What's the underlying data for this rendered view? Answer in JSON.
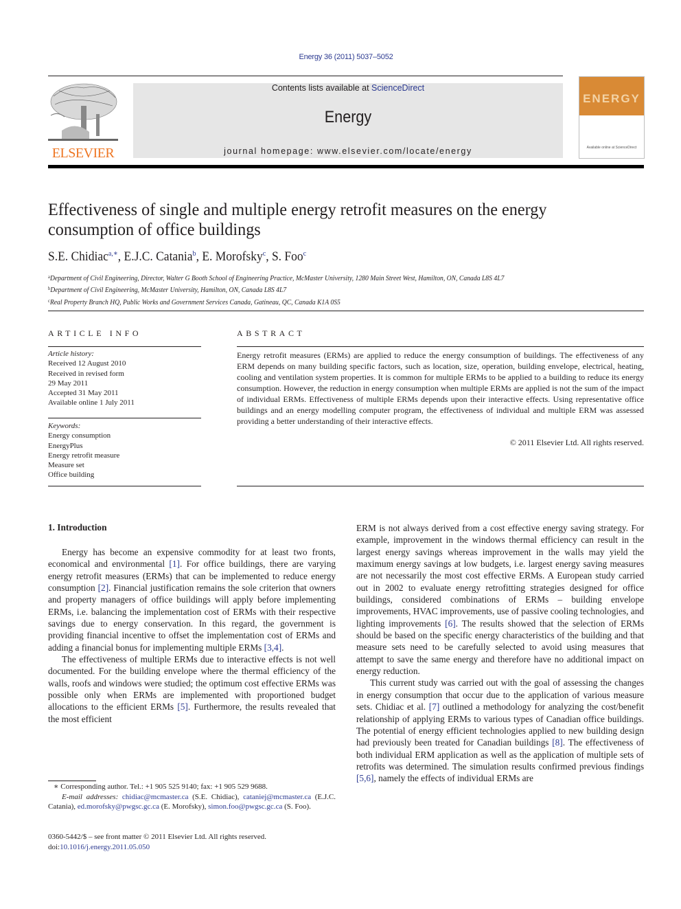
{
  "header": {
    "journal_reference": "Energy 36 (2011) 5037–5052",
    "contents_prefix": "Contents lists available at ",
    "contents_link": "ScienceDirect",
    "journal_name": "Energy",
    "homepage": "journal homepage: www.elsevier.com/locate/energy",
    "publisher_wordmark": "ELSEVIER",
    "cover_title": "ENERGY",
    "cover_footer": "Available online at ScienceDirect",
    "colors": {
      "link": "#2b3990",
      "elsevier_orange": "#ee7623",
      "cover_orange": "#d98a35",
      "header_box": "#e6e6e6"
    }
  },
  "article": {
    "title": "Effectiveness of single and multiple energy retrofit measures on the energy consumption of office buildings",
    "authors": [
      {
        "name": "S.E. Chidiac",
        "sup": "a,∗",
        "sep": ", "
      },
      {
        "name": "E.J.C. Catania",
        "sup": "b",
        "sep": ", "
      },
      {
        "name": "E. Morofsky",
        "sup": "c",
        "sep": ", "
      },
      {
        "name": "S. Foo",
        "sup": "c",
        "sep": ""
      }
    ],
    "affiliations": [
      {
        "mark": "a",
        "text": "Department of Civil Engineering, Director, Walter G Booth School of Engineering Practice, McMaster University, 1280 Main Street West, Hamilton, ON, Canada L8S 4L7"
      },
      {
        "mark": "b",
        "text": "Department of Civil Engineering, McMaster University, Hamilton, ON, Canada L8S 4L7"
      },
      {
        "mark": "c",
        "text": "Real Property Branch HQ, Public Works and Government Services Canada, Gatineau, QC, Canada K1A 0S5"
      }
    ]
  },
  "article_info": {
    "heading": "ARTICLE INFO",
    "history_label": "Article history:",
    "history": [
      "Received 12 August 2010",
      "Received in revised form",
      "29 May 2011",
      "Accepted 31 May 2011",
      "Available online 1 July 2011"
    ],
    "keywords_label": "Keywords:",
    "keywords": [
      "Energy consumption",
      "EnergyPlus",
      "Energy retrofit measure",
      "Measure set",
      "Office building"
    ]
  },
  "abstract": {
    "heading": "ABSTRACT",
    "text": "Energy retrofit measures (ERMs) are applied to reduce the energy consumption of buildings. The effectiveness of any ERM depends on many building specific factors, such as location, size, operation, building envelope, electrical, heating, cooling and ventilation system properties. It is common for multiple ERMs to be applied to a building to reduce its energy consumption. However, the reduction in energy consumption when multiple ERMs are applied is not the sum of the impact of individual ERMs. Effectiveness of multiple ERMs depends upon their interactive effects. Using representative office buildings and an energy modelling computer program, the effectiveness of individual and multiple ERM was assessed providing a better understanding of their interactive effects.",
    "copyright": "© 2011 Elsevier Ltd. All rights reserved."
  },
  "body": {
    "section_heading": "1.  Introduction",
    "p1": {
      "t1": "Energy has become an expensive commodity for at least two fronts, economical and environmental ",
      "c1": "[1]",
      "t2": ". For office buildings, there are varying energy retrofit measures (ERMs) that can be implemented to reduce energy consumption ",
      "c2": "[2]",
      "t3": ". Financial justification remains the sole criterion that owners and property managers of office buildings will apply before implementing ERMs, i.e. balancing the implementation cost of ERMs with their respective savings due to energy conservation. In this regard, the government is providing financial incentive to offset the implementation cost of ERMs and adding a financial bonus for implementing multiple ERMs ",
      "c3": "[3,4]",
      "t4": "."
    },
    "p2": {
      "t1": "The effectiveness of multiple ERMs due to interactive effects is not well documented. For the building envelope where the thermal efficiency of the walls, roofs and windows were studied; the optimum cost effective ERMs was possible only when ERMs are implemented with proportioned budget allocations to the efficient ERMs ",
      "c1": "[5]",
      "t2": ". Furthermore, the results revealed that the most efficient"
    },
    "p3": {
      "t1": "ERM is not always derived from a cost effective energy saving strategy. For example, improvement in the windows thermal efficiency can result in the largest energy savings whereas improvement in the walls may yield the maximum energy savings at low budgets, i.e. largest energy saving measures are not necessarily the most cost effective ERMs. A European study carried out in 2002 to evaluate energy retrofitting strategies designed for office buildings, considered combinations of ERMs – building envelope improvements, HVAC improvements, use of passive cooling technologies, and lighting improvements ",
      "c1": "[6]",
      "t2": ". The results showed that the selection of ERMs should be based on the specific energy characteristics of the building and that measure sets need to be carefully selected to avoid using measures that attempt to save the same energy and therefore have no additional impact on energy reduction."
    },
    "p4": {
      "t1": "This current study was carried out with the goal of assessing the changes in energy consumption that occur due to the application of various measure sets. Chidiac et al. ",
      "c1": "[7]",
      "t2": " outlined a methodology for analyzing the cost/benefit relationship of applying ERMs to various types of Canadian office buildings. The potential of energy efficient technologies applied to new building design had previously been treated for Canadian buildings ",
      "c2": "[8]",
      "t3": ". The effectiveness of both individual ERM application as well as the application of multiple sets of retrofits was determined. The simulation results confirmed previous findings ",
      "c3": "[5,6]",
      "t4": ", namely the effects of individual ERMs are"
    }
  },
  "footnotes": {
    "corresponding": "∗  Corresponding author. Tel.: +1 905 525 9140; fax: +1 905 529 9688.",
    "email_label": "E-mail addresses:",
    "emails": [
      {
        "address": "chidiac@mcmaster.ca",
        "owner": " (S.E. Chidiac), "
      },
      {
        "address": "cataniej@mcmaster.ca",
        "owner": " (E.J.C. Catania), "
      },
      {
        "address": "ed.morofsky@pwgsc.gc.ca",
        "owner": " (E. Morofsky), "
      },
      {
        "address": "simon.foo@pwgsc.gc.ca",
        "owner": " (S. Foo)."
      }
    ],
    "issn_line": "0360-5442/$ – see front matter © 2011 Elsevier Ltd. All rights reserved.",
    "doi_prefix": "doi:",
    "doi": "10.1016/j.energy.2011.05.050"
  }
}
